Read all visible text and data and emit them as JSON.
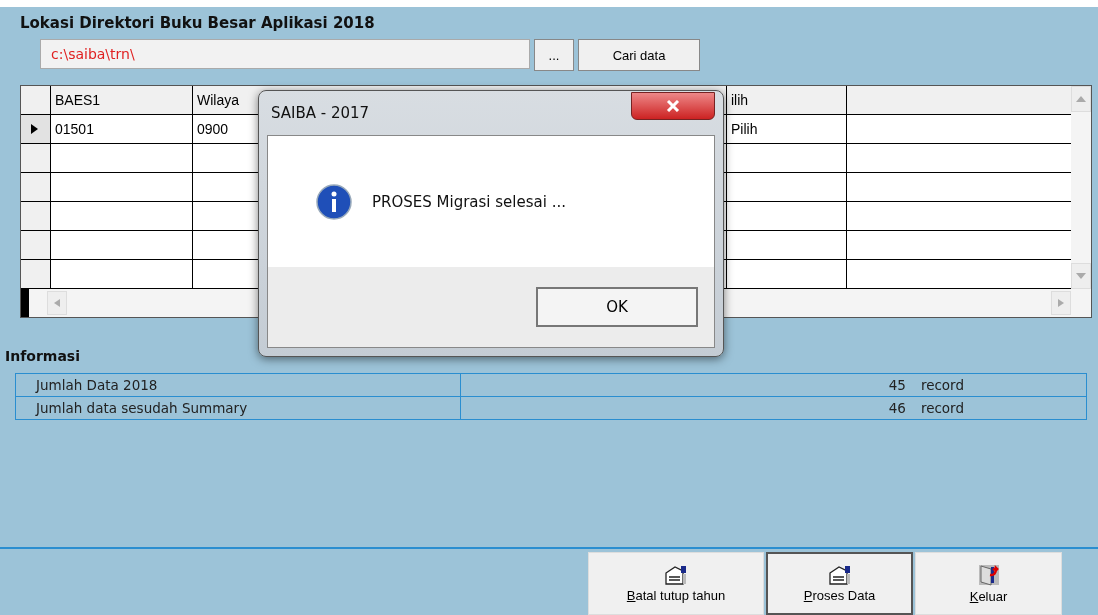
{
  "form_title": "Lokasi Direktori Buku Besar Aplikasi 2018",
  "path_field": {
    "value": "c:\\saiba\\trn\\"
  },
  "browse_button": "...",
  "search_button": "Cari data",
  "grid": {
    "columns": [
      {
        "label": "BAES1"
      },
      {
        "label": "Wilaya"
      },
      {
        "label": "ilih"
      }
    ],
    "rows": [
      {
        "current": true,
        "cells": [
          "01501",
          "0900",
          "Pilih"
        ]
      },
      {
        "current": false
      },
      {
        "current": false
      },
      {
        "current": false
      },
      {
        "current": false
      },
      {
        "current": false
      }
    ]
  },
  "dialog": {
    "title": "SAIBA - 2017",
    "message": "PROSES Migrasi selesai ...",
    "button": "OK"
  },
  "info": {
    "title": "Informasi",
    "rows": [
      {
        "label": "Jumlah Data 2018",
        "count": "45",
        "unit": "record"
      },
      {
        "label": "Jumlah data sesudah Summary",
        "count": "46",
        "unit": "record"
      }
    ]
  },
  "buttons": [
    {
      "label": "Batal tutup tahun",
      "kind": "form",
      "focused": false
    },
    {
      "label": "Proses Data",
      "kind": "form",
      "focused": true
    },
    {
      "label": "Keluar",
      "kind": "exit",
      "focused": false
    }
  ]
}
